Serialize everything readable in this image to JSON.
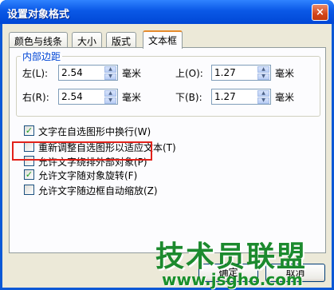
{
  "window": {
    "title": "设置对象格式",
    "close_glyph": "×"
  },
  "tabs": [
    {
      "label": "颜色与线条",
      "active": false
    },
    {
      "label": "大小",
      "active": false
    },
    {
      "label": "版式",
      "active": false
    },
    {
      "label": "文本框",
      "active": true
    }
  ],
  "internal_margin": {
    "title": "内部边距",
    "left": {
      "label": "左(L):",
      "value": "2.54",
      "unit": "毫米"
    },
    "right": {
      "label": "右(R):",
      "value": "2.54",
      "unit": "毫米"
    },
    "top": {
      "label": "上(O):",
      "value": "1.27",
      "unit": "毫米"
    },
    "bottom": {
      "label": "下(B):",
      "value": "1.27",
      "unit": "毫米"
    }
  },
  "options": [
    {
      "label": "文字在自选图形中换行(W)",
      "checked": true,
      "enabled": true
    },
    {
      "label": "重新调整自选图形以适应文本(T)",
      "checked": false,
      "enabled": true
    },
    {
      "label": "允许文字绕排外部对象(P)",
      "checked": false,
      "enabled": true
    },
    {
      "label": "允许文字随对象旋转(F)",
      "checked": true,
      "enabled": true
    },
    {
      "label": "允许文字随边框自动缩放(Z)",
      "checked": false,
      "enabled": true
    }
  ],
  "buttons": {
    "ok": "确定",
    "cancel": "取消"
  },
  "watermark": {
    "main": "技术员联盟",
    "url": "www.jsgho.com"
  },
  "colors": {
    "highlight_border": "#e2221a",
    "watermark_green": "#1c8a2e",
    "titlebar_blue": "#0a58e6"
  }
}
